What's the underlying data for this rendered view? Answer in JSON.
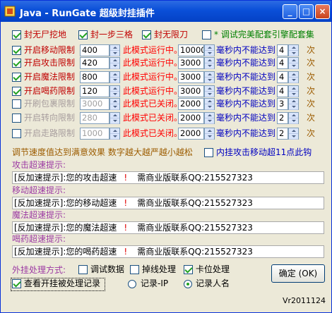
{
  "window": {
    "title": "Java - RunGate 超级封挂插件",
    "min": "_",
    "max": "□",
    "close": "×"
  },
  "top_options": [
    {
      "label": "封无尸挖地",
      "checked": true
    },
    {
      "label": "封一步三格",
      "checked": true
    },
    {
      "label": "封无限刀",
      "checked": true
    },
    {
      "label": "* 调试完美配套引擎配套集",
      "checked": false
    }
  ],
  "speed_rows": [
    {
      "label": "开启移动限制",
      "checked": true,
      "value": "400",
      "status": "此模式运行中。",
      "ms": "10000",
      "ms_suffix": "毫秒内不能达到",
      "count": "4",
      "unit": "次"
    },
    {
      "label": "开启攻击限制",
      "checked": true,
      "value": "420",
      "status": "此模式运行中。",
      "ms": "3000",
      "ms_suffix": "毫秒内不能达到",
      "count": "4",
      "unit": "次"
    },
    {
      "label": "开启魔法限制",
      "checked": true,
      "value": "800",
      "status": "此模式运行中。",
      "ms": "3000",
      "ms_suffix": "毫秒内不能达到",
      "count": "4",
      "unit": "次"
    },
    {
      "label": "开启喝药限制",
      "checked": true,
      "value": "120",
      "status": "此模式运行中。",
      "ms": "3000",
      "ms_suffix": "毫秒内不能达到",
      "count": "4",
      "unit": "次"
    },
    {
      "label": "开刷包裹限制",
      "checked": false,
      "value": "3000",
      "status": "此模式已关闭。",
      "ms": "2000",
      "ms_suffix": "毫秒内不能达到",
      "count": "3",
      "unit": "次"
    },
    {
      "label": "开启转向限制",
      "checked": false,
      "value": "280",
      "status": "此模式已关闭。",
      "ms": "2000",
      "ms_suffix": "毫秒内不能达到",
      "count": "2",
      "unit": "次"
    },
    {
      "label": "开启走路限制",
      "checked": false,
      "value": "1000",
      "status": "此模式已关闭。",
      "ms": "2000",
      "ms_suffix": "毫秒内不能达到",
      "count": "2",
      "unit": "次"
    }
  ],
  "tune_note": "调节速度值达到满意效果 数字越大越严越小越松",
  "inner_attack": {
    "label": "内挂攻击移动超11点此钩",
    "checked": false
  },
  "hints": [
    {
      "title": "攻击超速提示:",
      "prefix": "[反加速提示]:您的攻击超速",
      "mark": "!",
      "contact": "需商业版联系QQ:215527323"
    },
    {
      "title": "移动超速提示:",
      "prefix": "[反加速提示]:您的移动超速",
      "mark": "!",
      "contact": "需商业版联系QQ:215527323"
    },
    {
      "title": "魔法超速提示:",
      "prefix": "[反加速提示]:您的魔法超速",
      "mark": "!",
      "contact": "需商业版联系QQ:215527323"
    },
    {
      "title": "喝药超速提示:",
      "prefix": "[反加速提示]:您的喝药超速",
      "mark": "!",
      "contact": "需商业版联系QQ:215527323"
    }
  ],
  "handling": {
    "label": "外挂处理方式:",
    "options": [
      {
        "label": "调试数据",
        "checked": false
      },
      {
        "label": "掉线处理",
        "checked": false
      },
      {
        "label": "卡位处理",
        "checked": true
      }
    ]
  },
  "view_record": {
    "label": "查看开挂被处理记录",
    "checked": true
  },
  "record_mode": [
    {
      "label": "记录-IP",
      "selected": false
    },
    {
      "label": "记录人名",
      "selected": true
    }
  ],
  "ok_button": "确定 (OK)",
  "version": "Vr2011124",
  "colors": {
    "titlebar": "#0a4fd8",
    "label_red": "#c00000",
    "disabled": "#a89e9e",
    "hint_title": "#9c3aa3",
    "face": "#ece9d8"
  }
}
